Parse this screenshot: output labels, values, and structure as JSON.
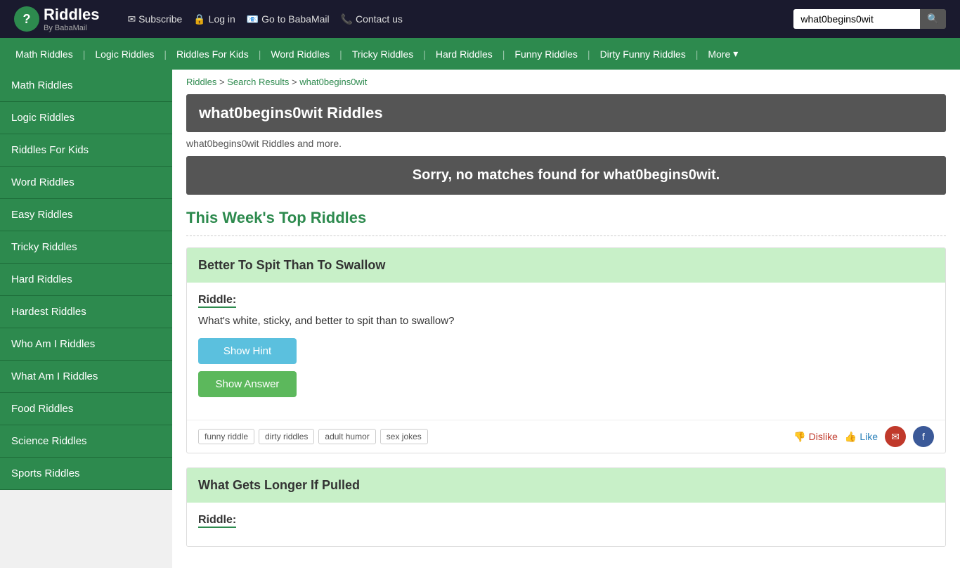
{
  "header": {
    "logo_icon": "?",
    "logo_text": "Riddles",
    "logo_sub": "By BabaMail",
    "nav": [
      {
        "label": "✉ Subscribe",
        "name": "subscribe-link"
      },
      {
        "label": "🔒 Log in",
        "name": "login-link"
      },
      {
        "label": "📧 Go to BabaMail",
        "name": "babamail-link"
      },
      {
        "label": "📞 Contact us",
        "name": "contact-link"
      }
    ],
    "search_placeholder": "what0begins0wit",
    "search_value": "what0begins0wit"
  },
  "top_nav": {
    "items": [
      {
        "label": "Math Riddles",
        "name": "nav-math"
      },
      {
        "label": "Logic Riddles",
        "name": "nav-logic"
      },
      {
        "label": "Riddles For Kids",
        "name": "nav-kids"
      },
      {
        "label": "Word Riddles",
        "name": "nav-word"
      },
      {
        "label": "Tricky Riddles",
        "name": "nav-tricky"
      },
      {
        "label": "Hard Riddles",
        "name": "nav-hard"
      },
      {
        "label": "Funny Riddles",
        "name": "nav-funny"
      },
      {
        "label": "Dirty Funny Riddles",
        "name": "nav-dirty"
      }
    ],
    "more_label": "More"
  },
  "sidebar": {
    "items": [
      {
        "label": "Math Riddles",
        "name": "sidebar-math"
      },
      {
        "label": "Logic Riddles",
        "name": "sidebar-logic"
      },
      {
        "label": "Riddles For Kids",
        "name": "sidebar-kids"
      },
      {
        "label": "Word Riddles",
        "name": "sidebar-word"
      },
      {
        "label": "Easy Riddles",
        "name": "sidebar-easy"
      },
      {
        "label": "Tricky Riddles",
        "name": "sidebar-tricky"
      },
      {
        "label": "Hard Riddles",
        "name": "sidebar-hard"
      },
      {
        "label": "Hardest Riddles",
        "name": "sidebar-hardest"
      },
      {
        "label": "Who Am I Riddles",
        "name": "sidebar-whoami"
      },
      {
        "label": "What Am I Riddles",
        "name": "sidebar-whatami"
      },
      {
        "label": "Food Riddles",
        "name": "sidebar-food"
      },
      {
        "label": "Science Riddles",
        "name": "sidebar-science"
      },
      {
        "label": "Sports Riddles",
        "name": "sidebar-sports"
      }
    ]
  },
  "breadcrumb": {
    "riddles_label": "Riddles",
    "search_results_label": "Search Results",
    "current_label": "what0begins0wit"
  },
  "main": {
    "page_title": "what0begins0wit Riddles",
    "subtitle": "what0begins0wit Riddles and more.",
    "no_results_text": "Sorry, no matches found for what0begins0wit.",
    "top_riddles_heading": "This Week's Top Riddles",
    "riddles": [
      {
        "title": "Better To Spit Than To Swallow",
        "riddle_label": "Riddle:",
        "riddle_text": "What's white, sticky, and better to spit than to swallow?",
        "hint_btn": "Show Hint",
        "answer_btn": "Show Answer",
        "tags": [
          "funny riddle",
          "dirty riddles",
          "adult humor",
          "sex jokes"
        ],
        "dislike_label": "Dislike",
        "like_label": "Like"
      },
      {
        "title": "What Gets Longer If Pulled",
        "riddle_label": "Riddle:",
        "riddle_text": ""
      }
    ]
  }
}
